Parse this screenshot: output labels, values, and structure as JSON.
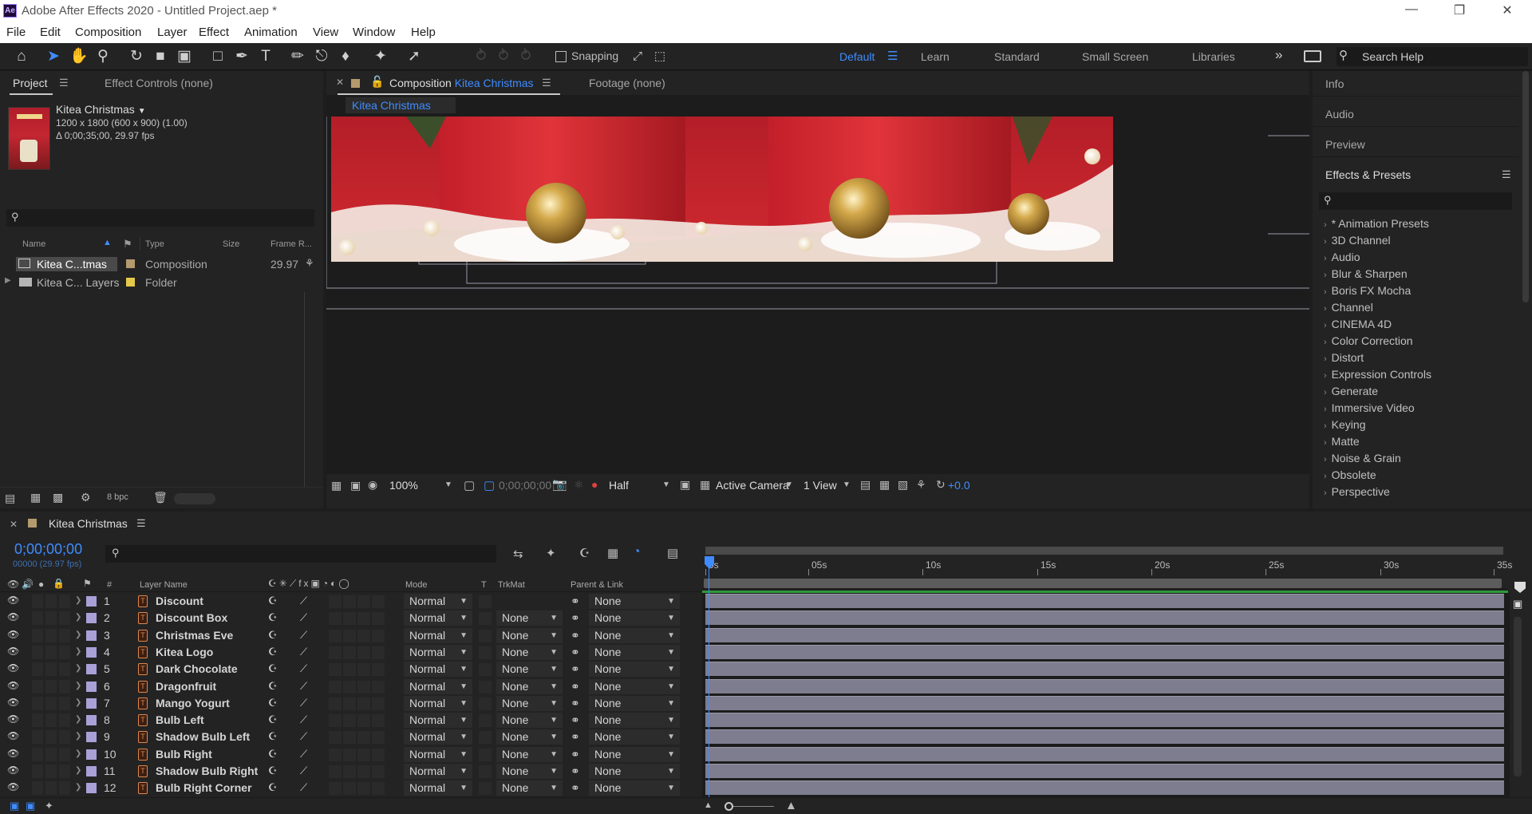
{
  "window": {
    "title": "Adobe After Effects 2020 - Untitled Project.aep *",
    "app_icon_text": "Ae"
  },
  "menu": [
    "File",
    "Edit",
    "Composition",
    "Layer",
    "Effect",
    "Animation",
    "View",
    "Window",
    "Help"
  ],
  "toolbar": {
    "snapping_label": "Snapping",
    "workspaces": [
      "Default",
      "Learn",
      "Standard",
      "Small Screen",
      "Libraries"
    ],
    "active_workspace": "Default",
    "more_glyph": "»",
    "search_placeholder": "Search Help"
  },
  "project_panel": {
    "tab_project": "Project",
    "tab_effect_controls": "Effect Controls (none)",
    "selected_item": {
      "name": "Kitea Christmas",
      "dims": "1200 x 1800  (600 x 900) (1.00)",
      "duration": "Δ 0;00;35;00, 29.97 fps"
    },
    "columns": [
      "Name",
      "Type",
      "Size",
      "Frame R..."
    ],
    "rows": [
      {
        "name": "Kitea C...tmas",
        "type": "Composition",
        "size": "",
        "fps": "29.97",
        "color": "#b59a6e"
      },
      {
        "name": "Kitea C... Layers",
        "type": "Folder",
        "size": "",
        "fps": "",
        "color": "#e5c84a"
      }
    ],
    "bpc": "8 bpc"
  },
  "composition_panel": {
    "tab_prefix": "Composition",
    "tab_comp_name": "Kitea Christmas",
    "tab_footage": "Footage  (none)",
    "breadcrumb": "Kitea Christmas",
    "zoom": "100%",
    "timecode": "0;00;00;00",
    "resolution": "Half",
    "camera": "Active Camera",
    "views": "1 View",
    "exposure": "+0.0"
  },
  "right_panels": {
    "info": "Info",
    "audio": "Audio",
    "preview": "Preview",
    "effects_presets": "Effects & Presets",
    "categories": [
      "* Animation Presets",
      "3D Channel",
      "Audio",
      "Blur & Sharpen",
      "Boris FX Mocha",
      "Channel",
      "CINEMA 4D",
      "Color Correction",
      "Distort",
      "Expression Controls",
      "Generate",
      "Immersive Video",
      "Keying",
      "Matte",
      "Noise & Grain",
      "Obsolete",
      "Perspective"
    ]
  },
  "timeline": {
    "comp_name": "Kitea Christmas",
    "timecode": "0;00;00;00",
    "frame_info": "00000 (29.97 fps)",
    "columns": {
      "number": "#",
      "layer_name": "Layer Name",
      "mode": "Mode",
      "t": "T",
      "trkmat": "TrkMat",
      "parent": "Parent & Link"
    },
    "ruler_labels": [
      "0s",
      "05s",
      "10s",
      "15s",
      "20s",
      "25s",
      "30s",
      "35s"
    ],
    "layers": [
      {
        "num": "1",
        "name": "Discount",
        "mode": "Normal",
        "trkmat": "",
        "parent": "None"
      },
      {
        "num": "2",
        "name": "Discount Box",
        "mode": "Normal",
        "trkmat": "None",
        "parent": "None"
      },
      {
        "num": "3",
        "name": "Christmas Eve",
        "mode": "Normal",
        "trkmat": "None",
        "parent": "None"
      },
      {
        "num": "4",
        "name": "Kitea Logo",
        "mode": "Normal",
        "trkmat": "None",
        "parent": "None"
      },
      {
        "num": "5",
        "name": "Dark Chocolate",
        "mode": "Normal",
        "trkmat": "None",
        "parent": "None"
      },
      {
        "num": "6",
        "name": "Dragonfruit",
        "mode": "Normal",
        "trkmat": "None",
        "parent": "None"
      },
      {
        "num": "7",
        "name": "Mango Yogurt",
        "mode": "Normal",
        "trkmat": "None",
        "parent": "None"
      },
      {
        "num": "8",
        "name": "Bulb Left",
        "mode": "Normal",
        "trkmat": "None",
        "parent": "None"
      },
      {
        "num": "9",
        "name": "Shadow Bulb Left",
        "mode": "Normal",
        "trkmat": "None",
        "parent": "None"
      },
      {
        "num": "10",
        "name": "Bulb Right",
        "mode": "Normal",
        "trkmat": "None",
        "parent": "None"
      },
      {
        "num": "11",
        "name": "Shadow Bulb Right",
        "mode": "Normal",
        "trkmat": "None",
        "parent": "None"
      },
      {
        "num": "12",
        "name": "Bulb Right Corner",
        "mode": "Normal",
        "trkmat": "None",
        "parent": "None"
      }
    ]
  },
  "colors": {
    "accent": "#3f8cff",
    "panel_bg": "#232323",
    "layer_bar": "#7e7d8f",
    "layer_label": "#a9a0d8"
  }
}
